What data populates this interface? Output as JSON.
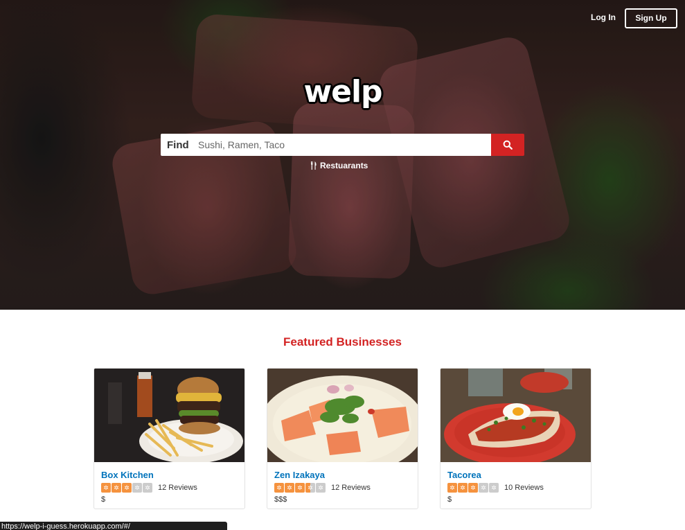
{
  "nav": {
    "login_label": "Log In",
    "signup_label": "Sign Up"
  },
  "logo": {
    "text": "welp"
  },
  "search": {
    "find_label": "Find",
    "placeholder": "Sushi, Ramen, Taco",
    "value": "",
    "button_icon": "search-icon",
    "accent_color": "#d32323"
  },
  "category": {
    "icon": "fork-knife-icon",
    "label": "Restuarants"
  },
  "featured": {
    "title": "Featured Businesses",
    "businesses": [
      {
        "name": "Box Kitchen",
        "rating": 3,
        "max_rating": 5,
        "reviews": "12 Reviews",
        "price": "$",
        "photo": "burger-and-fries-photo"
      },
      {
        "name": "Zen Izakaya",
        "rating": 3.5,
        "max_rating": 5,
        "reviews": "12 Reviews",
        "price": "$$$",
        "photo": "salmon-salad-photo"
      },
      {
        "name": "Tacorea",
        "rating": 3,
        "max_rating": 5,
        "reviews": "10 Reviews",
        "price": "$",
        "photo": "burrito-with-egg-photo"
      }
    ]
  },
  "status_bar": {
    "url": "https://welp-i-guess.herokuapp.com/#/"
  },
  "colors": {
    "brand_red": "#d32323",
    "link_blue": "#0073bb",
    "star_orange": "#f5923e",
    "star_empty": "#cccccc"
  }
}
